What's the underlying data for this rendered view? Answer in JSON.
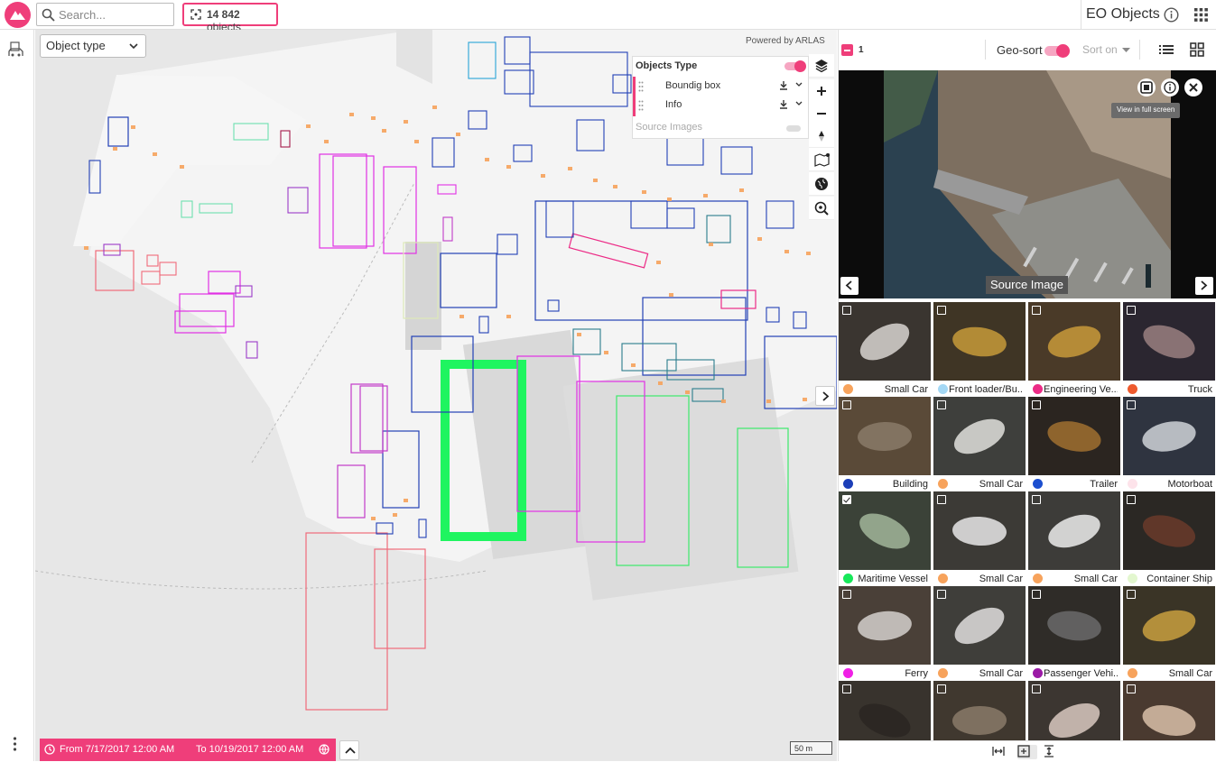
{
  "search": {
    "placeholder": "Search..."
  },
  "count": {
    "value": "14 842",
    "unit": "objects"
  },
  "app": {
    "title": "EO Objects"
  },
  "map": {
    "object_type_select": "Object type",
    "powered_by": "Powered by ARLAS",
    "layer_panel": {
      "title": "Objects Type",
      "rows": [
        {
          "label": "Boundig box"
        },
        {
          "label": "Info"
        }
      ],
      "source_images": "Source Images"
    },
    "scale": "50 m",
    "timeline": {
      "from": "From  7/17/2017 12:00 AM",
      "to": "To  10/19/2017 12:00 AM"
    }
  },
  "results": {
    "selected_count": "1",
    "geosort_label": "Geo-sort",
    "sort_on": "Sort on",
    "preview": {
      "tooltip": "View in full screen",
      "label": "Source Image"
    },
    "cards": [
      {
        "label": "Small Car",
        "color": "#f7a35c",
        "checked": false
      },
      {
        "label": "Front loader/Bu...",
        "color": "#a4d8f5",
        "checked": false
      },
      {
        "label": "Engineering Ve...",
        "color": "#ec2b86",
        "checked": false
      },
      {
        "label": "Truck",
        "color": "#ee5a2e",
        "checked": false
      },
      {
        "label": "Building",
        "color": "#1c3fb8",
        "checked": false
      },
      {
        "label": "Small Car",
        "color": "#f7a35c",
        "checked": false
      },
      {
        "label": "Trailer",
        "color": "#1c4fcf",
        "checked": false
      },
      {
        "label": "Motorboat",
        "color": "#fde3ea",
        "checked": false
      },
      {
        "label": "Maritime Vessel",
        "color": "#17e85a",
        "checked": true
      },
      {
        "label": "Small Car",
        "color": "#f7a35c",
        "checked": false
      },
      {
        "label": "Small Car",
        "color": "#f7a35c",
        "checked": false
      },
      {
        "label": "Container Ship",
        "color": "#e3f7cf",
        "checked": false
      },
      {
        "label": "Ferry",
        "color": "#f020e6",
        "checked": false
      },
      {
        "label": "Small Car",
        "color": "#f7a35c",
        "checked": false
      },
      {
        "label": "Passenger Vehi...",
        "color": "#9b1aa6",
        "checked": false
      },
      {
        "label": "Small Car",
        "color": "#f7a35c",
        "checked": false
      },
      {
        "label": "",
        "color": "",
        "checked": false
      },
      {
        "label": "",
        "color": "",
        "checked": false
      },
      {
        "label": "",
        "color": "",
        "checked": false
      },
      {
        "label": "",
        "color": "",
        "checked": false
      }
    ]
  },
  "colors": {
    "accent": "#ef3e7a"
  }
}
